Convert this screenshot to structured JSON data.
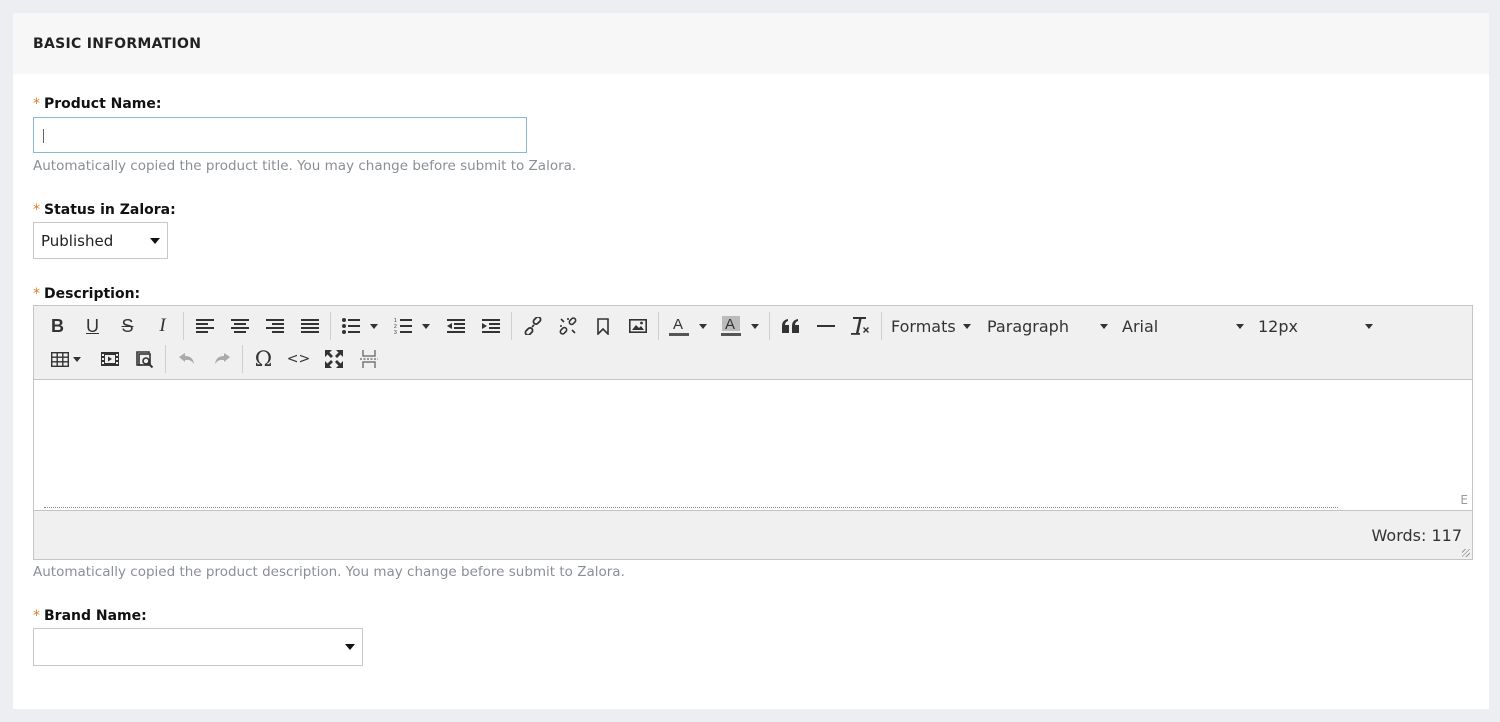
{
  "card": {
    "title": "BASIC INFORMATION"
  },
  "product_name": {
    "required_mark": "*",
    "label": "Product Name:",
    "value": "",
    "help": "Automatically copied the product title. You may change before submit to Zalora."
  },
  "status": {
    "required_mark": "*",
    "label": "Status in Zalora:",
    "selected": "Published"
  },
  "description": {
    "required_mark": "*",
    "label": "Description:",
    "toolbar": {
      "formats_label": "Formats",
      "block_format": "Paragraph",
      "font_family": "Arial",
      "font_size": "12px",
      "special_char_glyph": "Ω",
      "code_glyph": "<>"
    },
    "word_count": "Words: 117",
    "help": "Automatically copied the product description. You may change before submit to Zalora."
  },
  "brand": {
    "required_mark": "*",
    "label": "Brand Name:",
    "selected": ""
  },
  "colors": {
    "required": "#e07b2a",
    "help_text": "#8a8f96",
    "input_focus_border": "#8bb6db",
    "header_bg": "#f8f7f8"
  }
}
